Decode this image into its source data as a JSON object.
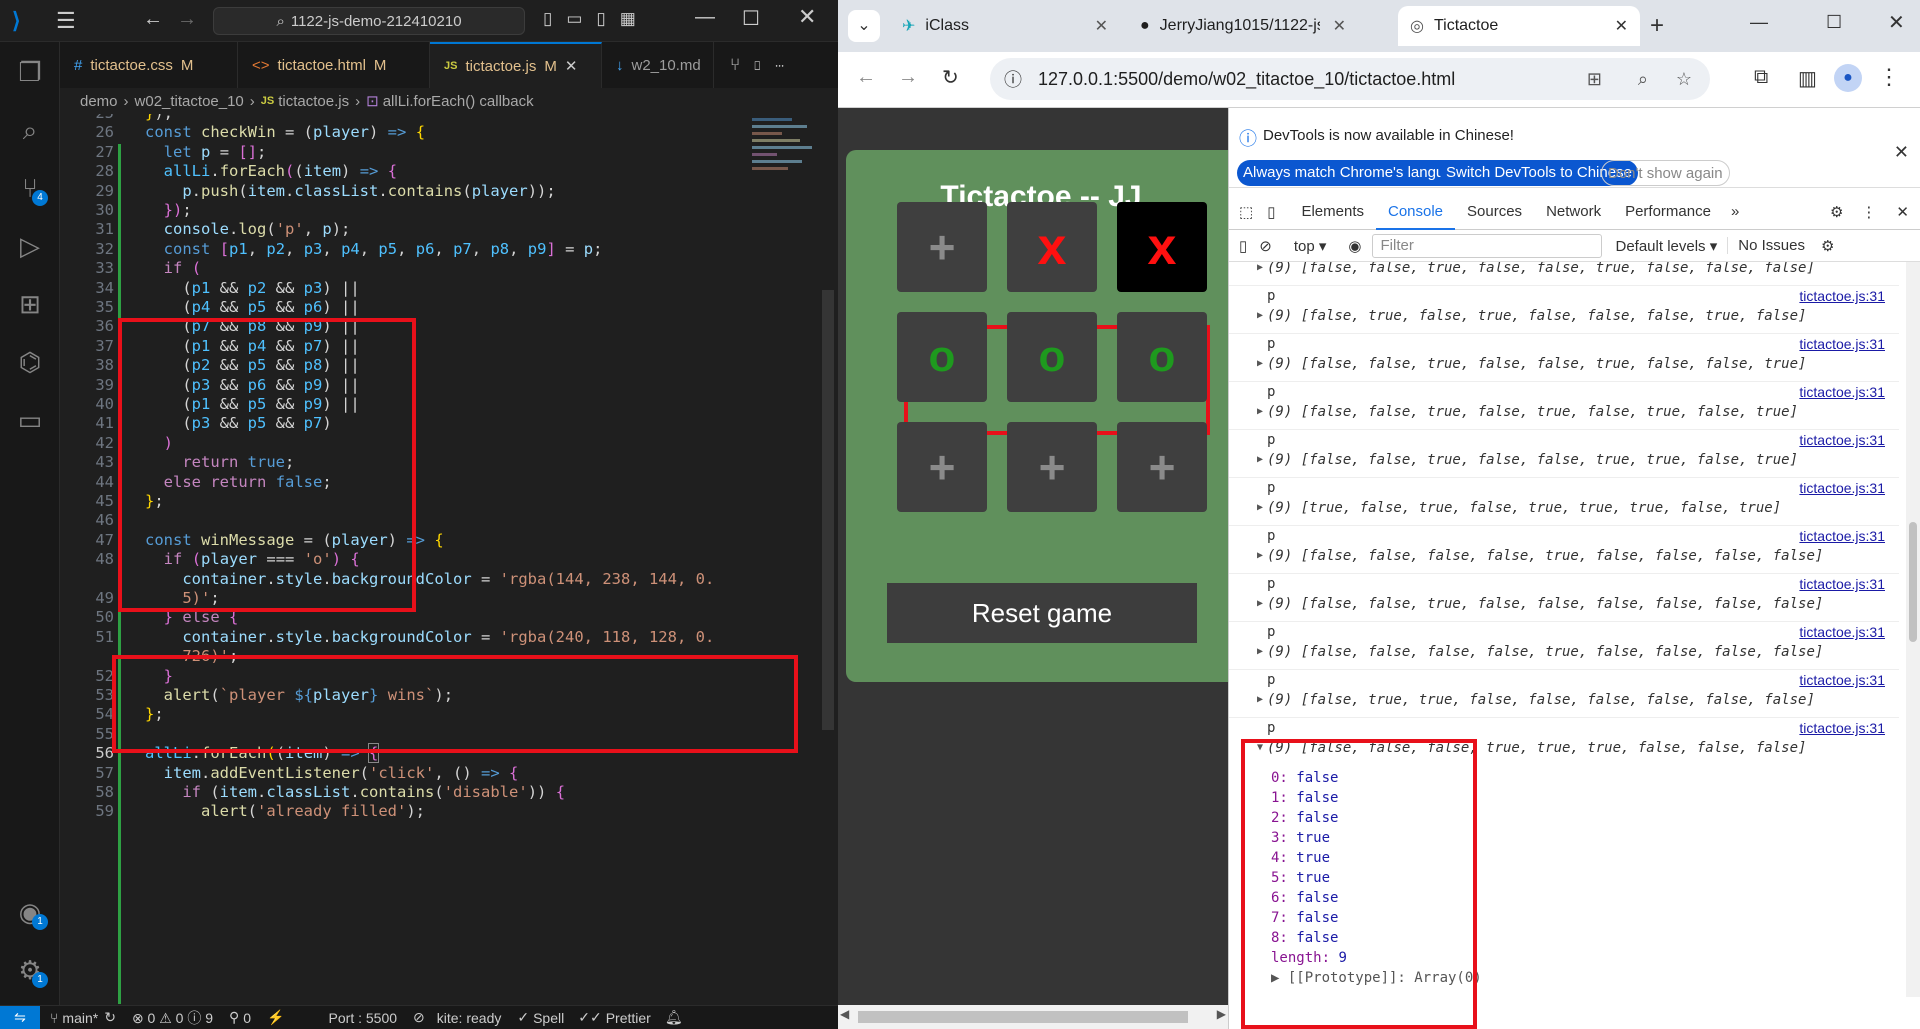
{
  "vscode": {
    "search_text": "1122-js-demo-212410210",
    "tabs": [
      {
        "icon": "#",
        "name": "tictactoe.css",
        "mark": "M"
      },
      {
        "icon": "<>",
        "name": "tictactoe.html",
        "mark": "M"
      },
      {
        "icon": "JS",
        "name": "tictactoe.js",
        "mark": "M"
      },
      {
        "icon": "↓",
        "name": "w2_10.md",
        "mark": ""
      }
    ],
    "breadcrumb": [
      "demo",
      "w02_titactoe_10",
      "tictactoe.js",
      "allLi.forEach() callback"
    ],
    "activity_badges": {
      "source_control": "4",
      "accounts": "1",
      "settings": "1"
    },
    "line_numbers": [
      "25",
      "26",
      "27",
      "28",
      "29",
      "30",
      "31",
      "32",
      "33",
      "34",
      "35",
      "36",
      "37",
      "38",
      "39",
      "40",
      "41",
      "42",
      "43",
      "44",
      "45",
      "46",
      "47",
      "48",
      "",
      "49",
      "50",
      "51",
      "",
      "52",
      "53",
      "54",
      "55",
      "56",
      "57",
      "58",
      "59"
    ],
    "status": {
      "branch": "main*",
      "problems": "⊗ 0 ⚠ 0 ⓘ 9",
      "ports": "0",
      "port": "Port : 5500",
      "kite": "kite: ready",
      "spell": "Spell",
      "prettier": "Prettier"
    }
  },
  "chrome": {
    "tabs": [
      "iClass",
      "JerryJiang1015/1122-js",
      "Tictactoe"
    ],
    "url": "127.0.0.1:5500/demo/w02_titactoe_10/tictactoe.html",
    "page": {
      "title": "Tictactoe -- JJ",
      "cells": [
        "+",
        "x",
        "x",
        "o",
        "o",
        "o",
        "+",
        "+",
        "+"
      ],
      "reset_label": "Reset game"
    },
    "devtools": {
      "info_text": "DevTools is now available in Chinese!",
      "btn_match": "Always match Chrome's language",
      "btn_switch": "Switch DevTools to Chinese",
      "btn_dont": "Don't show again",
      "tabs": [
        "Elements",
        "Console",
        "Sources",
        "Network",
        "Performance"
      ],
      "context": "top",
      "filter_placeholder": "Filter",
      "levels": "Default levels",
      "issues": "No Issues",
      "entries": [
        {
          "label": "p",
          "src": "tictactoe.js:31",
          "arr": "(9) [false, false, true, false, false, true, false, false, false]"
        },
        {
          "label": "p",
          "src": "tictactoe.js:31",
          "arr": "(9) [false, true, false, true, false, false, false, true, false]"
        },
        {
          "label": "p",
          "src": "tictactoe.js:31",
          "arr": "(9) [false, false, true, false, false, true, false, false, true]"
        },
        {
          "label": "p",
          "src": "tictactoe.js:31",
          "arr": "(9) [false, false, true, false, true, false, true, false, true]"
        },
        {
          "label": "p",
          "src": "tictactoe.js:31",
          "arr": "(9) [false, false, true, false, false, true, true, false, true]"
        },
        {
          "label": "p",
          "src": "tictactoe.js:31",
          "arr": "(9) [true, false, true, false, true, true, true, false, true]"
        },
        {
          "label": "p",
          "src": "tictactoe.js:31",
          "arr": "(9) [false, false, false, false, true, false, false, false, false]"
        },
        {
          "label": "p",
          "src": "tictactoe.js:31",
          "arr": "(9) [false, false, true, false, false, false, false, false, false]"
        },
        {
          "label": "p",
          "src": "tictactoe.js:31",
          "arr": "(9) [false, false, false, false, true, false, false, false, false]"
        },
        {
          "label": "p",
          "src": "tictactoe.js:31",
          "arr": "(9) [false, true, true, false, false, false, false, false, false]"
        },
        {
          "label": "p",
          "src": "tictactoe.js:31",
          "arr": "(9) [false, false, false, true, true, true, false, false, false]"
        }
      ],
      "expanded": [
        {
          "k": "0",
          "v": "false"
        },
        {
          "k": "1",
          "v": "false"
        },
        {
          "k": "2",
          "v": "false"
        },
        {
          "k": "3",
          "v": "true"
        },
        {
          "k": "4",
          "v": "true"
        },
        {
          "k": "5",
          "v": "true"
        },
        {
          "k": "6",
          "v": "false"
        },
        {
          "k": "7",
          "v": "false"
        },
        {
          "k": "8",
          "v": "false"
        },
        {
          "k": "length",
          "v": "9"
        }
      ],
      "prototype": "[[Prototype]]: Array(0)"
    }
  }
}
